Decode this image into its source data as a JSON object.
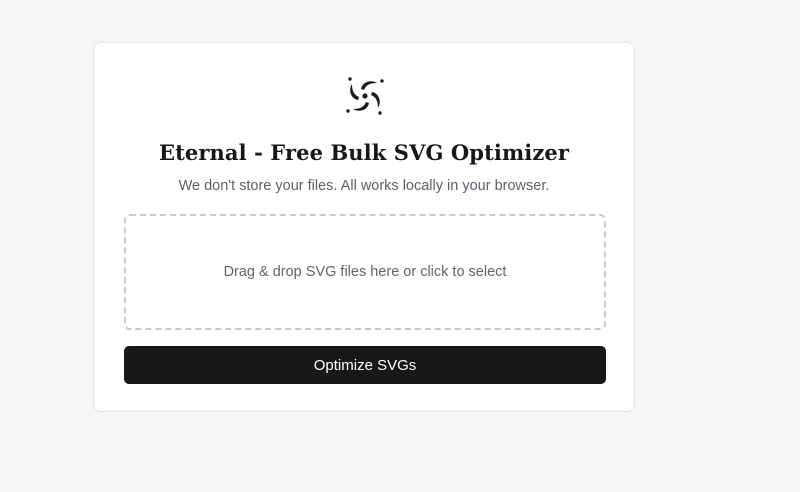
{
  "card": {
    "logo_icon": "swirl-logo-icon",
    "title": "Eternal - Free Bulk SVG Optimizer",
    "subtitle": "We don't store your files. All works locally in your browser."
  },
  "dropzone": {
    "label": "Drag & drop SVG files here or click to select"
  },
  "actions": {
    "optimize_label": "Optimize SVGs"
  },
  "colors": {
    "background": "#f6f6f7",
    "card": "#ffffff",
    "primary_button": "#18181b",
    "text_primary": "#17171a",
    "text_secondary": "#5e6068",
    "dropzone_border": "#c9c9cc"
  }
}
